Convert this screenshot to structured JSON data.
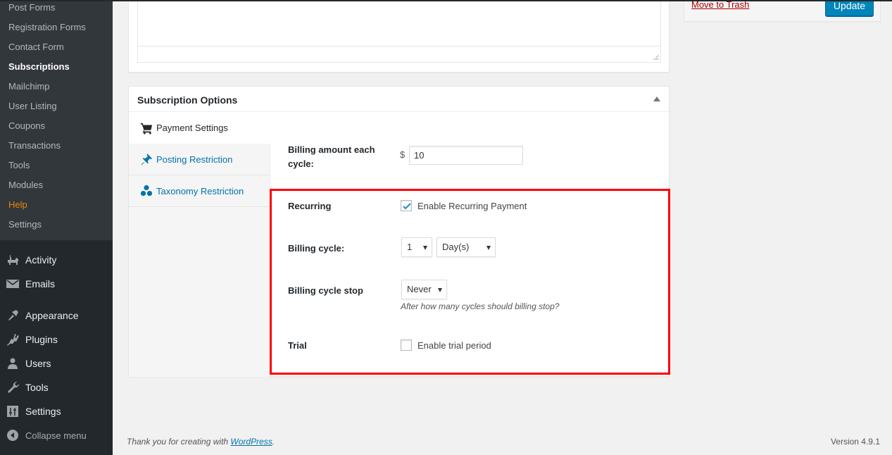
{
  "sidebar": {
    "submenu": [
      {
        "label": "Post Forms",
        "state": "normal"
      },
      {
        "label": "Registration Forms",
        "state": "normal"
      },
      {
        "label": "Contact Form",
        "state": "normal"
      },
      {
        "label": "Subscriptions",
        "state": "current"
      },
      {
        "label": "Mailchimp",
        "state": "normal"
      },
      {
        "label": "User Listing",
        "state": "normal"
      },
      {
        "label": "Coupons",
        "state": "normal"
      },
      {
        "label": "Transactions",
        "state": "normal"
      },
      {
        "label": "Tools",
        "state": "normal"
      },
      {
        "label": "Modules",
        "state": "normal"
      },
      {
        "label": "Help",
        "state": "highlight"
      },
      {
        "label": "Settings",
        "state": "normal"
      }
    ],
    "menu": [
      {
        "label": "Activity",
        "icon": "activity-icon"
      },
      {
        "label": "Emails",
        "icon": "envelope-icon"
      },
      {
        "label": "Appearance",
        "icon": "paintbrush-icon"
      },
      {
        "label": "Plugins",
        "icon": "plugin-icon"
      },
      {
        "label": "Users",
        "icon": "user-icon"
      },
      {
        "label": "Tools",
        "icon": "wrench-icon"
      },
      {
        "label": "Settings",
        "icon": "settings-sliders-icon"
      }
    ],
    "collapse_label": "Collapse menu"
  },
  "publish": {
    "trash_label": "Move to Trash",
    "update_label": "Update"
  },
  "subscription": {
    "title": "Subscription Options",
    "tabs": [
      {
        "label": "Payment Settings",
        "icon": "cart-icon",
        "active": true
      },
      {
        "label": "Posting Restriction",
        "icon": "pin-icon",
        "active": false
      },
      {
        "label": "Taxonomy Restriction",
        "icon": "groups-icon",
        "active": false
      }
    ],
    "fields": {
      "billing_amount_label": "Billing amount each cycle:",
      "currency_symbol": "$",
      "billing_amount_value": "10",
      "recurring_label": "Recurring",
      "recurring_checkbox_label": "Enable Recurring Payment",
      "recurring_checked": true,
      "billing_cycle_label": "Billing cycle:",
      "billing_cycle_number": "1",
      "billing_cycle_unit": "Day(s)",
      "billing_cycle_stop_label": "Billing cycle stop",
      "billing_cycle_stop_value": "Never",
      "billing_cycle_stop_help": "After how many cycles should billing stop?",
      "trial_label": "Trial",
      "trial_checkbox_label": "Enable trial period",
      "trial_checked": false
    }
  },
  "colors": {
    "highlight_border": "#ff0000",
    "accent": "#0073aa",
    "help_menu": "#f18500"
  },
  "footer": {
    "thanks_prefix": "Thank you for creating with ",
    "wordpress_link": "WordPress",
    "thanks_suffix": ".",
    "version": "Version 4.9.1"
  }
}
